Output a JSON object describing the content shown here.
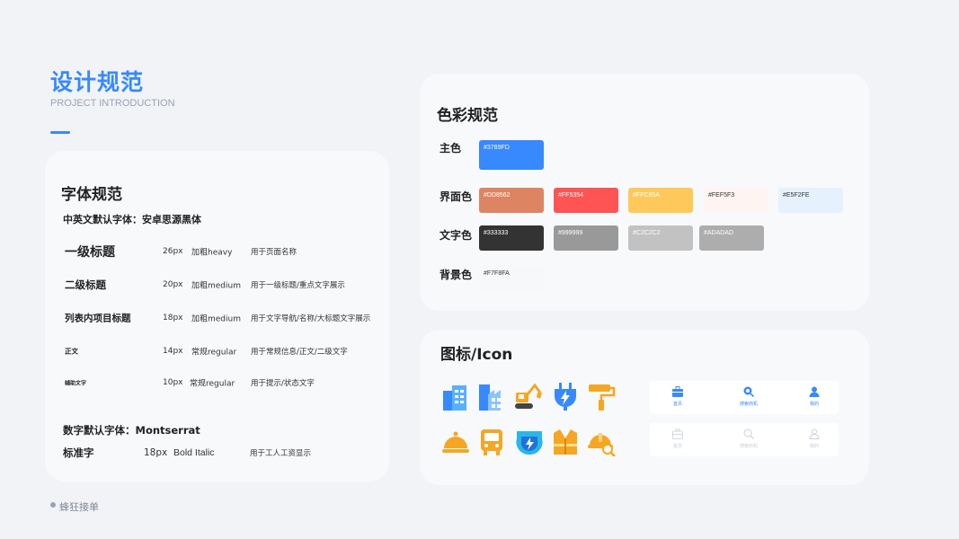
{
  "header": {
    "title": "设计规范",
    "subtitle": "PROJECT INTRODUCTION"
  },
  "font_card": {
    "title": "字体规范",
    "cn_default": "中英文默认字体：安卓思源黑体",
    "rows": [
      {
        "name": "一级标题",
        "size": "26px",
        "weight": "加粗heavy",
        "usage": "用于页面名称"
      },
      {
        "name": "二级标题",
        "size": "20px",
        "weight": "加粗medium",
        "usage": "用于一级标题/重点文字展示"
      },
      {
        "name": "列表内项目标题",
        "size": "18px",
        "weight": "加粗medium",
        "usage": "用于文字导航/名称/大标题文字展示"
      },
      {
        "name": "正文",
        "size": "14px",
        "weight": "常规regular",
        "usage": "用于常规信息/正文/二级文字"
      },
      {
        "name": "辅助文字",
        "size": "10px",
        "weight": "常规regular",
        "usage": "用于提示/状态文字"
      }
    ],
    "num_default": "数字默认字体：Montserrat",
    "num_row": {
      "name": "标准字",
      "size": "18px",
      "weight": "Bold Italic",
      "usage": "用于工人工资显示"
    }
  },
  "color_card": {
    "title": "色彩规范",
    "groups": [
      {
        "label": "主色",
        "swatches": [
          {
            "hex": "#3789FD",
            "text": "#3789FD",
            "text_color": "#FFFFFF"
          }
        ]
      },
      {
        "label": "界面色",
        "swatches": [
          {
            "hex": "#DD8562",
            "text": "#DD8562",
            "text_color": "#FFFFFF"
          },
          {
            "hex": "#FF5354",
            "text": "#FF5354",
            "text_color": "#FFFFFF"
          },
          {
            "hex": "#FFC85A",
            "text": "#FFC85A",
            "text_color": "#FFFFFF"
          },
          {
            "hex": "#FEF5F3",
            "text": "#FEF5F3",
            "text_color": "#333333"
          },
          {
            "hex": "#E5F2FE",
            "text": "#E5F2FE",
            "text_color": "#333333"
          }
        ]
      },
      {
        "label": "文字色",
        "swatches": [
          {
            "hex": "#333333",
            "text": "#333333",
            "text_color": "#FFFFFF"
          },
          {
            "hex": "#999999",
            "text": "#999999",
            "text_color": "#FFFFFF"
          },
          {
            "hex": "#C2C2C2",
            "text": "#C2C2C2",
            "text_color": "#FFFFFF"
          },
          {
            "hex": "#ADADAD",
            "text": "#ADADAD",
            "text_color": "#FFFFFF"
          }
        ]
      },
      {
        "label": "背景色",
        "swatches": [
          {
            "hex": "#F7F8FA",
            "text": "#F7F8FA",
            "text_color": "#333333"
          }
        ]
      }
    ]
  },
  "icon_card": {
    "title": "图标/Icon",
    "row1_icons": [
      "buildings-icon",
      "factory-icon",
      "excavator-icon",
      "power-plug-icon",
      "paint-roller-icon"
    ],
    "row2_icons": [
      "food-dome-icon",
      "bus-icon",
      "electric-shield-icon",
      "safety-vest-icon",
      "hard-hat-search-icon"
    ],
    "nav_active": [
      {
        "icon": "toolbox-icon",
        "label": "首页"
      },
      {
        "icon": "search-machine-icon",
        "label": "搜索商机"
      },
      {
        "icon": "user-icon",
        "label": "我的"
      }
    ],
    "nav_inactive": [
      {
        "icon": "toolbox-icon",
        "label": "首页"
      },
      {
        "icon": "search-machine-icon",
        "label": "搜索商机"
      },
      {
        "icon": "user-icon",
        "label": "我的"
      }
    ],
    "active_color": "#3789FD",
    "inactive_color": "#C9CED8"
  },
  "footer": {
    "text": "蜂狂接单"
  }
}
